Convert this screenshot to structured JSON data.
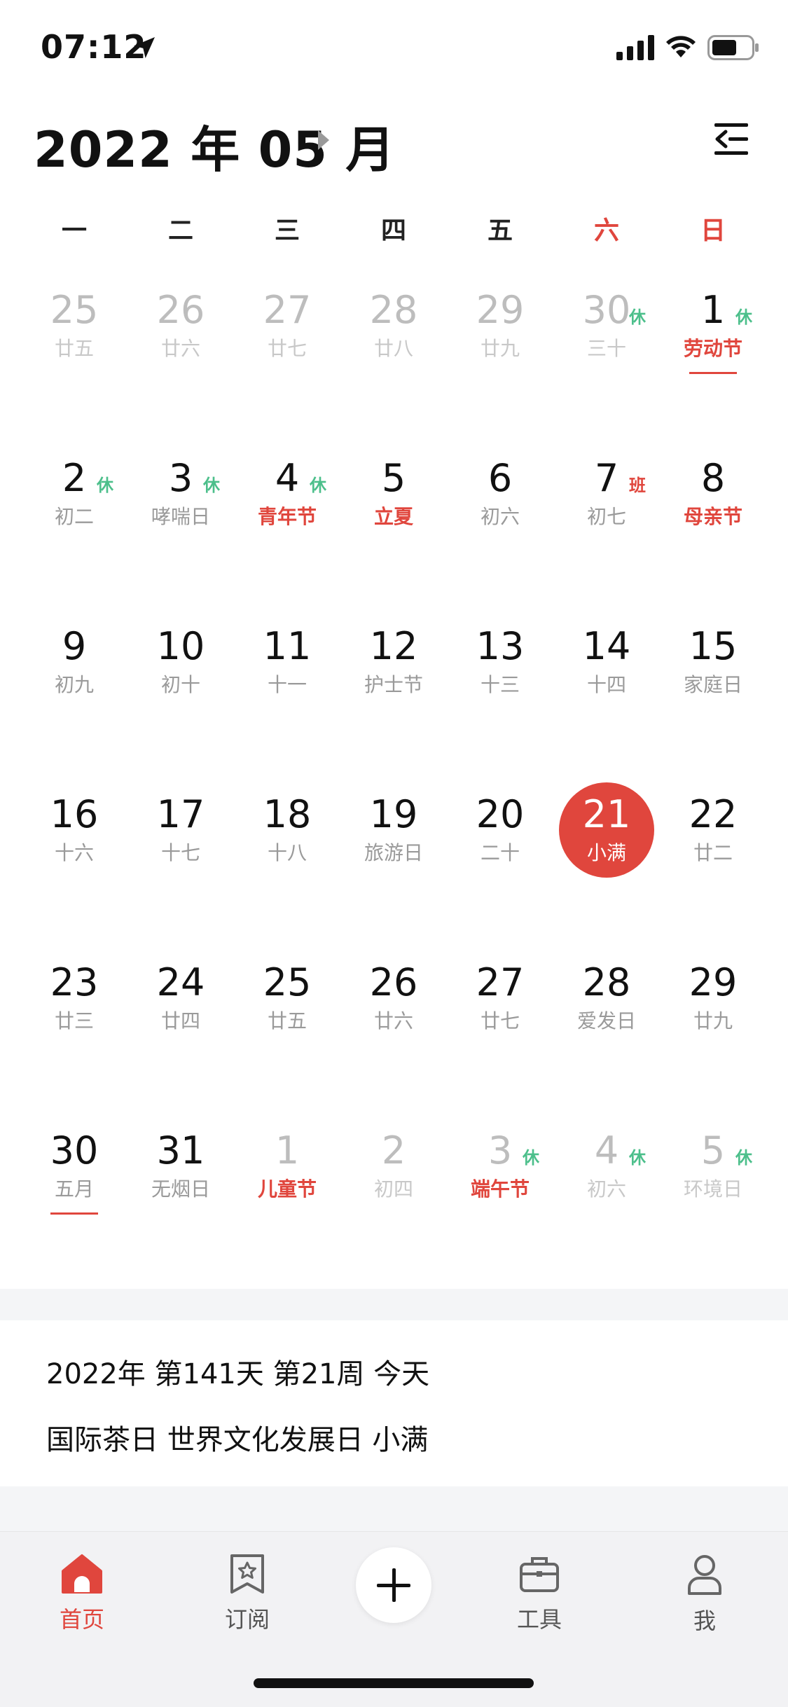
{
  "status": {
    "time": "07:12"
  },
  "header": {
    "title": "2022 年 05 月"
  },
  "weekdays": [
    "一",
    "二",
    "三",
    "四",
    "五",
    "六",
    "日"
  ],
  "weeks": [
    [
      {
        "d": "25",
        "l": "廿五",
        "other": true
      },
      {
        "d": "26",
        "l": "廿六",
        "other": true
      },
      {
        "d": "27",
        "l": "廿七",
        "other": true
      },
      {
        "d": "28",
        "l": "廿八",
        "other": true
      },
      {
        "d": "29",
        "l": "廿九",
        "other": true
      },
      {
        "d": "30",
        "l": "三十",
        "other": true,
        "tag": "休",
        "tagType": "rest"
      },
      {
        "d": "1",
        "l": "劳动节",
        "fest": true,
        "tag": "休",
        "tagType": "rest",
        "underline": true
      }
    ],
    [
      {
        "d": "2",
        "l": "初二",
        "tag": "休",
        "tagType": "rest"
      },
      {
        "d": "3",
        "l": "哮喘日",
        "tag": "休",
        "tagType": "rest"
      },
      {
        "d": "4",
        "l": "青年节",
        "fest": true,
        "tag": "休",
        "tagType": "rest"
      },
      {
        "d": "5",
        "l": "立夏",
        "fest": true
      },
      {
        "d": "6",
        "l": "初六"
      },
      {
        "d": "7",
        "l": "初七",
        "tag": "班",
        "tagType": "work"
      },
      {
        "d": "8",
        "l": "母亲节",
        "fest": true
      }
    ],
    [
      {
        "d": "9",
        "l": "初九"
      },
      {
        "d": "10",
        "l": "初十"
      },
      {
        "d": "11",
        "l": "十一"
      },
      {
        "d": "12",
        "l": "护士节"
      },
      {
        "d": "13",
        "l": "十三"
      },
      {
        "d": "14",
        "l": "十四"
      },
      {
        "d": "15",
        "l": "家庭日"
      }
    ],
    [
      {
        "d": "16",
        "l": "十六"
      },
      {
        "d": "17",
        "l": "十七"
      },
      {
        "d": "18",
        "l": "十八"
      },
      {
        "d": "19",
        "l": "旅游日"
      },
      {
        "d": "20",
        "l": "二十"
      },
      {
        "d": "21",
        "l": "小满",
        "today": true
      },
      {
        "d": "22",
        "l": "廿二"
      }
    ],
    [
      {
        "d": "23",
        "l": "廿三"
      },
      {
        "d": "24",
        "l": "廿四"
      },
      {
        "d": "25",
        "l": "廿五"
      },
      {
        "d": "26",
        "l": "廿六"
      },
      {
        "d": "27",
        "l": "廿七"
      },
      {
        "d": "28",
        "l": "爱发日"
      },
      {
        "d": "29",
        "l": "廿九"
      }
    ],
    [
      {
        "d": "30",
        "l": "五月",
        "underline": true
      },
      {
        "d": "31",
        "l": "无烟日"
      },
      {
        "d": "1",
        "l": "儿童节",
        "other": true,
        "fest": true
      },
      {
        "d": "2",
        "l": "初四",
        "other": true
      },
      {
        "d": "3",
        "l": "端午节",
        "other": true,
        "fest": true,
        "tag": "休",
        "tagType": "rest"
      },
      {
        "d": "4",
        "l": "初六",
        "other": true,
        "tag": "休",
        "tagType": "rest"
      },
      {
        "d": "5",
        "l": "环境日",
        "other": true,
        "tag": "休",
        "tagType": "rest"
      }
    ]
  ],
  "info": {
    "line1": "2022年 第141天 第21周 今天",
    "line2": "国际茶日   世界文化发展日   小满"
  },
  "tabs": {
    "home": "首页",
    "subscribe": "订阅",
    "tools": "工具",
    "me": "我"
  },
  "colors": {
    "accent": "#e0463d",
    "rest": "#4cbf8b"
  }
}
